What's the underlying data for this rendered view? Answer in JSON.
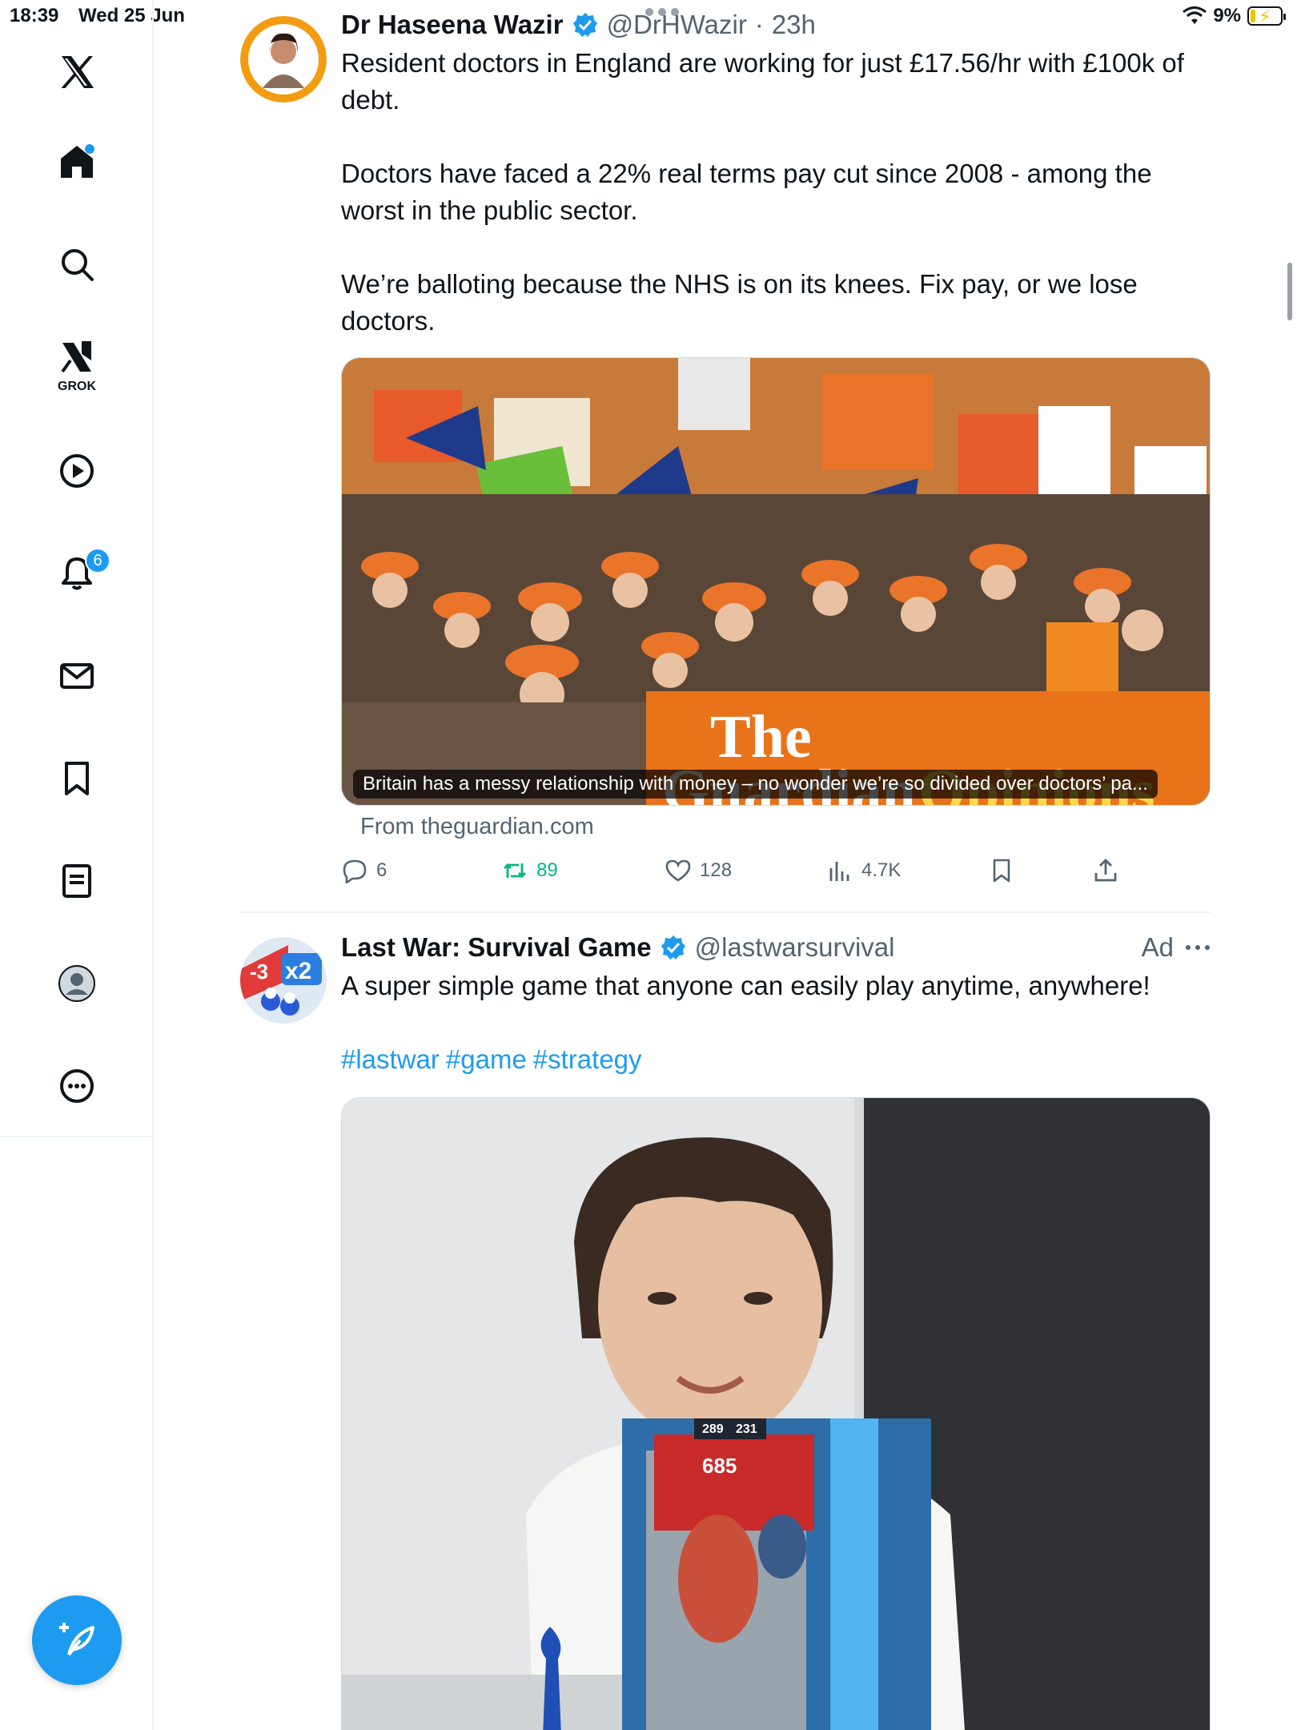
{
  "status_bar": {
    "time": "18:39",
    "date": "Wed 25 Jun",
    "battery": "9%"
  },
  "sidebar": {
    "items": [
      {
        "name": "home",
        "label": "Home"
      },
      {
        "name": "search",
        "label": "Search"
      },
      {
        "name": "grok",
        "label": "GROK"
      },
      {
        "name": "video",
        "label": "Video"
      },
      {
        "name": "notifications",
        "label": "Notifications",
        "badge": "6"
      },
      {
        "name": "messages",
        "label": "Messages"
      },
      {
        "name": "bookmarks",
        "label": "Bookmarks"
      },
      {
        "name": "lists",
        "label": "Lists"
      },
      {
        "name": "profile",
        "label": "Profile"
      },
      {
        "name": "more",
        "label": "More"
      }
    ]
  },
  "tweet1": {
    "author": "Dr Haseena Wazir",
    "handle": "@DrHWazir",
    "time": "23h",
    "text_p1": "Resident doctors in England are working for just £17.56/hr with £100k of debt.",
    "text_p2": "Doctors have faced a 22% real terms pay cut since 2008 - among the worst in the public sector.",
    "text_p3": "We’re balloting because the NHS is on its knees. Fix pay, or we lose doctors.",
    "card_caption": "Britain has a messy relationship with money – no wonder we’re so divided over doctors’ pa...",
    "card_source": "From theguardian.com",
    "replies": "6",
    "reposts": "89",
    "likes": "128",
    "views": "4.7K"
  },
  "tweet2": {
    "author": "Last War: Survival Game",
    "handle": "@lastwarsurvival",
    "ad_label": "Ad",
    "text": "A super simple game that anyone can easily play anytime, anywhere!",
    "hashtags": [
      "#lastwar",
      "#game",
      "#strategy"
    ],
    "game_scores": [
      "289",
      "231",
      "685"
    ]
  },
  "colors": {
    "accent": "#1d9bf0",
    "repost_green": "#00ba7c",
    "muted": "#536471"
  }
}
